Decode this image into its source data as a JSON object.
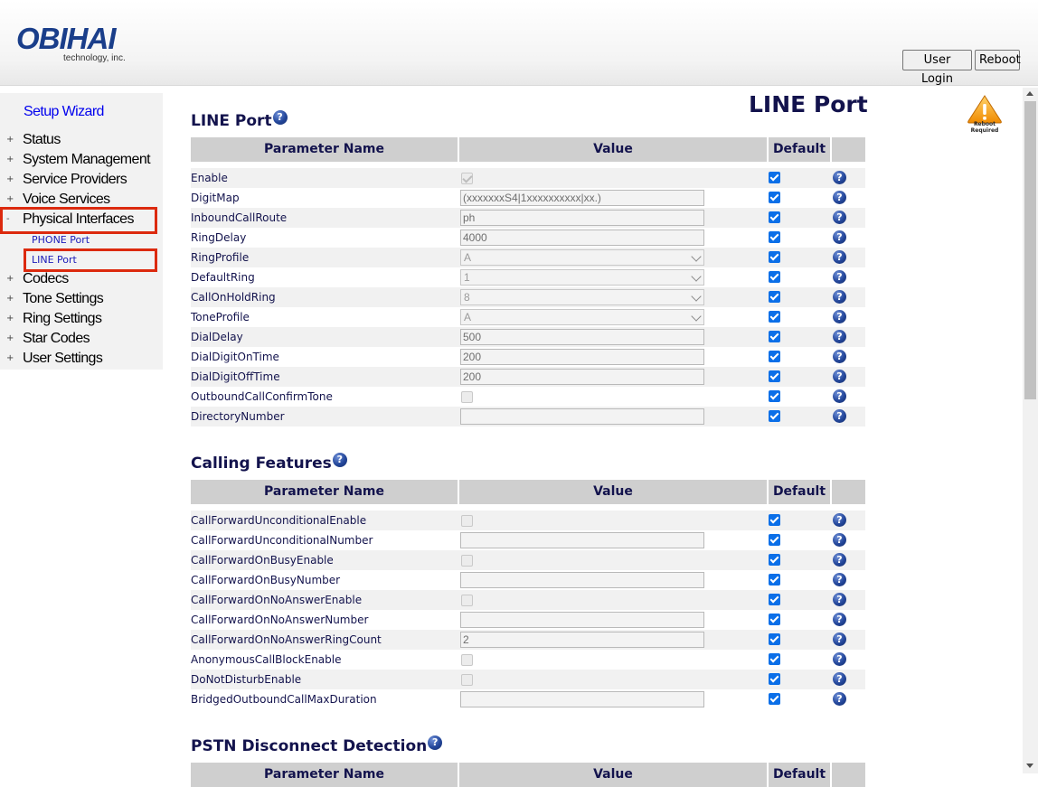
{
  "brand": {
    "name": "OBIHAI",
    "tagline": "technology, inc."
  },
  "header": {
    "login_label": "User Login",
    "reboot_label": "Reboot"
  },
  "sidebar": {
    "wizard": "Setup Wizard",
    "items": [
      {
        "label": "Status",
        "toggle": "+"
      },
      {
        "label": "System Management",
        "toggle": "+"
      },
      {
        "label": "Service Providers",
        "toggle": "+"
      },
      {
        "label": "Voice Services",
        "toggle": "+"
      },
      {
        "label": "Physical Interfaces",
        "toggle": "-"
      },
      {
        "label": "Codecs",
        "toggle": "+"
      },
      {
        "label": "Tone Settings",
        "toggle": "+"
      },
      {
        "label": "Ring Settings",
        "toggle": "+"
      },
      {
        "label": "Star Codes",
        "toggle": "+"
      },
      {
        "label": "User Settings",
        "toggle": "+"
      }
    ],
    "subitems": [
      "PHONE Port",
      "LINE Port"
    ]
  },
  "page": {
    "title": "LINE Port",
    "reboot_badge": "Reboot Required"
  },
  "table_headers": {
    "name": "Parameter Name",
    "value": "Value",
    "default": "Default"
  },
  "help_glyph": "?",
  "sections": [
    {
      "title": "LINE Port",
      "rows": [
        {
          "name": "Enable",
          "type": "check",
          "checked": true
        },
        {
          "name": "DigitMap",
          "type": "text",
          "value": "(xxxxxxxS4|1xxxxxxxxxx|xx.)"
        },
        {
          "name": "InboundCallRoute",
          "type": "text",
          "value": "ph"
        },
        {
          "name": "RingDelay",
          "type": "text",
          "value": "4000"
        },
        {
          "name": "RingProfile",
          "type": "select",
          "value": "A"
        },
        {
          "name": "DefaultRing",
          "type": "select",
          "value": "1"
        },
        {
          "name": "CallOnHoldRing",
          "type": "select",
          "value": "8"
        },
        {
          "name": "ToneProfile",
          "type": "select",
          "value": "A"
        },
        {
          "name": "DialDelay",
          "type": "text",
          "value": "500"
        },
        {
          "name": "DialDigitOnTime",
          "type": "text",
          "value": "200"
        },
        {
          "name": "DialDigitOffTime",
          "type": "text",
          "value": "200"
        },
        {
          "name": "OutboundCallConfirmTone",
          "type": "check",
          "checked": false
        },
        {
          "name": "DirectoryNumber",
          "type": "text",
          "value": ""
        }
      ]
    },
    {
      "title": "Calling Features",
      "rows": [
        {
          "name": "CallForwardUnconditionalEnable",
          "type": "check",
          "checked": false
        },
        {
          "name": "CallForwardUnconditionalNumber",
          "type": "text",
          "value": ""
        },
        {
          "name": "CallForwardOnBusyEnable",
          "type": "check",
          "checked": false
        },
        {
          "name": "CallForwardOnBusyNumber",
          "type": "text",
          "value": ""
        },
        {
          "name": "CallForwardOnNoAnswerEnable",
          "type": "check",
          "checked": false
        },
        {
          "name": "CallForwardOnNoAnswerNumber",
          "type": "text",
          "value": ""
        },
        {
          "name": "CallForwardOnNoAnswerRingCount",
          "type": "text",
          "value": "2"
        },
        {
          "name": "AnonymousCallBlockEnable",
          "type": "check",
          "checked": false
        },
        {
          "name": "DoNotDisturbEnable",
          "type": "check",
          "checked": false
        },
        {
          "name": "BridgedOutboundCallMaxDuration",
          "type": "text",
          "value": ""
        }
      ]
    },
    {
      "title": "PSTN Disconnect Detection",
      "rows": []
    }
  ],
  "colors": {
    "navy": "#13134d",
    "highlight": "#dc2a0e",
    "link": "#0000ee",
    "checkbox": "#0b6fe8"
  }
}
